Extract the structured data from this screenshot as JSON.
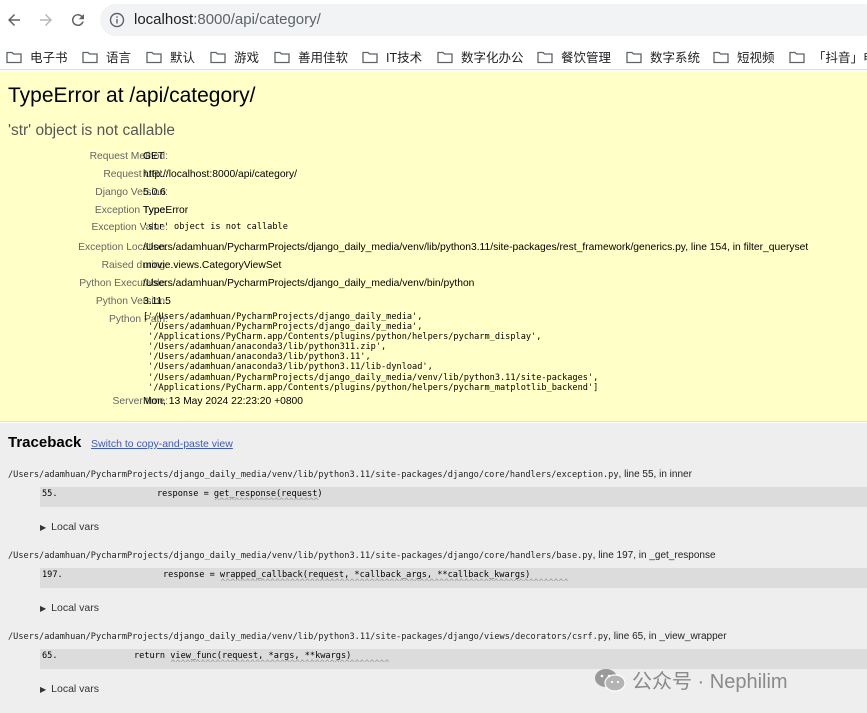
{
  "browser": {
    "url_host": "localhost",
    "url_rest": ":8000/api/category/",
    "bookmarks": [
      "电子书",
      "语言",
      "默认",
      "游戏",
      "善用佳软",
      "IT技术",
      "数字化办公",
      "餐饮管理",
      "数字系统",
      "短视频",
      "「抖音」电"
    ]
  },
  "error": {
    "title": "TypeError at /api/category/",
    "message": "'str' object is not callable"
  },
  "meta": [
    {
      "label": "Request Method:",
      "value": "GET",
      "mono": false
    },
    {
      "label": "Request URL:",
      "value": "http://localhost:8000/api/category/",
      "mono": false
    },
    {
      "label": "Django Version:",
      "value": "5.0.6",
      "mono": false
    },
    {
      "label": "Exception Type:",
      "value": "TypeError",
      "mono": false
    },
    {
      "label": "Exception Value:",
      "value": "'str' object is not callable",
      "mono": true
    },
    {
      "label": "Exception Location:",
      "value": "/Users/adamhuan/PycharmProjects/django_daily_media/venv/lib/python3.11/site-packages/rest_framework/generics.py, line 154, in filter_queryset",
      "mono": false
    },
    {
      "label": "Raised during:",
      "value": "movie.views.CategoryViewSet",
      "mono": false
    },
    {
      "label": "Python Executable:",
      "value": "/Users/adamhuan/PycharmProjects/django_daily_media/venv/bin/python",
      "mono": false
    },
    {
      "label": "Python Version:",
      "value": "3.11.5",
      "mono": false
    }
  ],
  "python_path_label": "Python Path:",
  "python_path": "['/Users/adamhuan/PycharmProjects/django_daily_media',\n '/Users/adamhuan/PycharmProjects/django_daily_media',\n '/Applications/PyCharm.app/Contents/plugins/python/helpers/pycharm_display',\n '/Users/adamhuan/anaconda3/lib/python311.zip',\n '/Users/adamhuan/anaconda3/lib/python3.11',\n '/Users/adamhuan/anaconda3/lib/python3.11/lib-dynload',\n '/Users/adamhuan/PycharmProjects/django_daily_media/venv/lib/python3.11/site-packages',\n '/Applications/PyCharm.app/Contents/plugins/python/helpers/pycharm_matplotlib_backend']",
  "server_time_label": "Server time:",
  "server_time": "Mon, 13 May 2024 22:23:20 +0800",
  "traceback": {
    "heading": "Traceback",
    "switch_link": "Switch to copy-and-paste view",
    "local_vars_label": "Local vars",
    "frames": [
      {
        "file": "/Users/adamhuan/PycharmProjects/django_daily_media/venv/lib/python3.11/site-packages/django/core/handlers/exception.py",
        "tail": ", line 55, in inner",
        "lineno": "55.",
        "code": "response = get_response(request)",
        "carets": "^^^^^^^^^^^^^^^^^^^^^"
      },
      {
        "file": "/Users/adamhuan/PycharmProjects/django_daily_media/venv/lib/python3.11/site-packages/django/core/handlers/base.py",
        "tail": ", line 197, in _get_response",
        "lineno": "197.",
        "code": "response = wrapped_callback(request, *callback_args, **callback_kwargs)",
        "carets": "^^^^^^^^^^^^^^^^^^^^^^^^^^^^^^^^^^^^^^^^^^^^^^^^^^^^^^^^^^^^^^^^^^^^^^"
      },
      {
        "file": "/Users/adamhuan/PycharmProjects/django_daily_media/venv/lib/python3.11/site-packages/django/views/decorators/csrf.py",
        "tail": ", line 65, in _view_wrapper",
        "lineno": "65.",
        "code": "return view_func(request, *args, **kwargs)",
        "carets": "^^^^^^^^^^^^^^^^^^^^^^^^^^^^^^^^^^^^^^^^^^^^"
      }
    ]
  },
  "watermark": "公众号 · Nephilim"
}
